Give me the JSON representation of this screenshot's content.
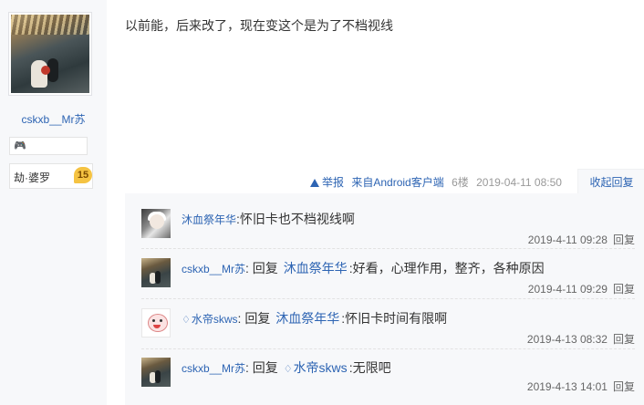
{
  "author": {
    "username": "cskxb__Mr苏",
    "badge_icon": "🎮",
    "level_name": "劫·婆罗",
    "level_num": "15"
  },
  "post": {
    "content": "以前能，后来改了，现在变这个是为了不档视线",
    "report_label": "举报",
    "client": "来自Android客户端",
    "floor": "6楼",
    "time": "2019-04-11 08:50",
    "collapse_label": "收起回复"
  },
  "replies": [
    {
      "user": "沐血祭年华",
      "user_prefix": "",
      "reply_word": "",
      "mention": "",
      "mention_prefix": "",
      "text": "怀旧卡也不档视线啊",
      "sep": ":",
      "time": "2019-4-11 09:28",
      "reply_btn": "回复"
    },
    {
      "user": "cskxb__Mr苏",
      "user_prefix": "",
      "reply_word": "回复",
      "mention": "沐血祭年华",
      "mention_prefix": "",
      "text": "好看，心理作用，整齐，各种原因",
      "sep": ":",
      "time": "2019-4-11 09:29",
      "reply_btn": "回复"
    },
    {
      "user": "水帝skws",
      "user_prefix": "♢",
      "reply_word": "回复",
      "mention": "沐血祭年华",
      "mention_prefix": "",
      "text": "怀旧卡时间有限啊",
      "sep": ":",
      "time": "2019-4-13 08:32",
      "reply_btn": "回复"
    },
    {
      "user": "cskxb__Mr苏",
      "user_prefix": "",
      "reply_word": "回复",
      "mention": "水帝skws",
      "mention_prefix": "♢",
      "text": "无限吧",
      "sep": ":",
      "time": "2019-4-13 14:01",
      "reply_btn": "回复"
    }
  ]
}
